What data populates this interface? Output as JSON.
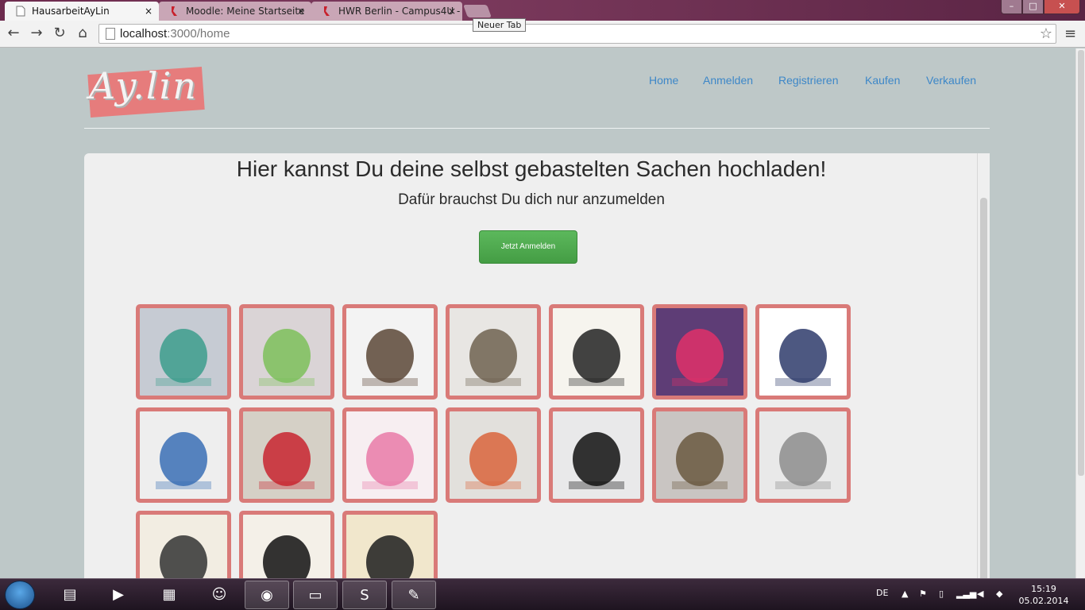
{
  "browser": {
    "tabs": [
      {
        "title": "HausarbeitAyLin",
        "close": "×"
      },
      {
        "title": "Moodle: Meine Startseite",
        "close": "×"
      },
      {
        "title": "HWR Berlin - Campus4U - ",
        "close": "×"
      }
    ],
    "tooltip": "Neuer Tab",
    "url_host": "localhost",
    "url_path": ":3000/home",
    "window_buttons": {
      "minimize": "–",
      "maximize": "□",
      "close": "✕"
    },
    "nav_icons": {
      "back": "←",
      "forward": "→",
      "reload": "↻",
      "home": "⌂",
      "star": "☆",
      "menu": "≡"
    }
  },
  "site": {
    "logo": "Ay.lin",
    "nav": [
      "Home",
      "Anmelden",
      "Registrieren",
      "Kaufen",
      "Verkaufen"
    ],
    "heading": "Hier kannst Du deine selbst gebastelten Sachen hochladen!",
    "subheading": "Dafür brauchst Du dich nur anzumelden",
    "cta": "Jetzt Anmelden",
    "accent": "#d97a78",
    "link_color": "#3d87c8",
    "gallery": [
      {
        "icon": "tassel-keychain-icon",
        "bg": "#c6cbd3",
        "fg": "#3c9e8c"
      },
      {
        "icon": "owl-plush-icon",
        "bg": "#dad4d6",
        "fg": "#7cbf5a"
      },
      {
        "icon": "brown-bag-icon",
        "bg": "#f3f3f3",
        "fg": "#5b4636"
      },
      {
        "icon": "scarf-icon",
        "bg": "#e8e6e3",
        "fg": "#6e6250"
      },
      {
        "icon": "clock-icon",
        "bg": "#f6f4ee",
        "fg": "#222222"
      },
      {
        "icon": "owl-pouch-icon",
        "bg": "#5e3d76",
        "fg": "#e0306a"
      },
      {
        "icon": "owl-bed-decal-icon",
        "bg": "#ffffff",
        "fg": "#2e3b6b"
      },
      {
        "icon": "castle-key-rack-icon",
        "bg": "#eeeeee",
        "fg": "#3a6fb5"
      },
      {
        "icon": "polka-dot-bag-icon",
        "bg": "#d5d0c6",
        "fg": "#c8242f"
      },
      {
        "icon": "pacifier-chain-icon",
        "bg": "#f7eef1",
        "fg": "#e97aa8"
      },
      {
        "icon": "flower-fabric-bowl-icon",
        "bg": "#e2e0dc",
        "fg": "#d9643c"
      },
      {
        "icon": "infinity-tote-icon",
        "bg": "#e9e9ea",
        "fg": "#111111"
      },
      {
        "icon": "mouse-door-icon",
        "bg": "#c9c5c2",
        "fg": "#6a5840"
      },
      {
        "icon": "chevron-pillow-chair-icon",
        "bg": "#e9e9e9",
        "fg": "#8d8d8d"
      },
      {
        "icon": "tote-bag-text-icon",
        "bg": "#f2ede2",
        "fg": "#333333"
      },
      {
        "icon": "hunger-tote-icon",
        "bg": "#f4f0e8",
        "fg": "#111111"
      },
      {
        "icon": "owl-phone-case-icon",
        "bg": "#f1e7cc",
        "fg": "#1d1d1d"
      }
    ]
  },
  "taskbar": {
    "apps": [
      "file-explorer-icon",
      "media-player-icon",
      "toolbox-icon",
      "messenger-icon",
      "chrome-icon",
      "command-prompt-icon",
      "sublime-text-icon",
      "paint-icon"
    ],
    "language": "DE",
    "time": "15:19",
    "date": "05.02.2014"
  }
}
